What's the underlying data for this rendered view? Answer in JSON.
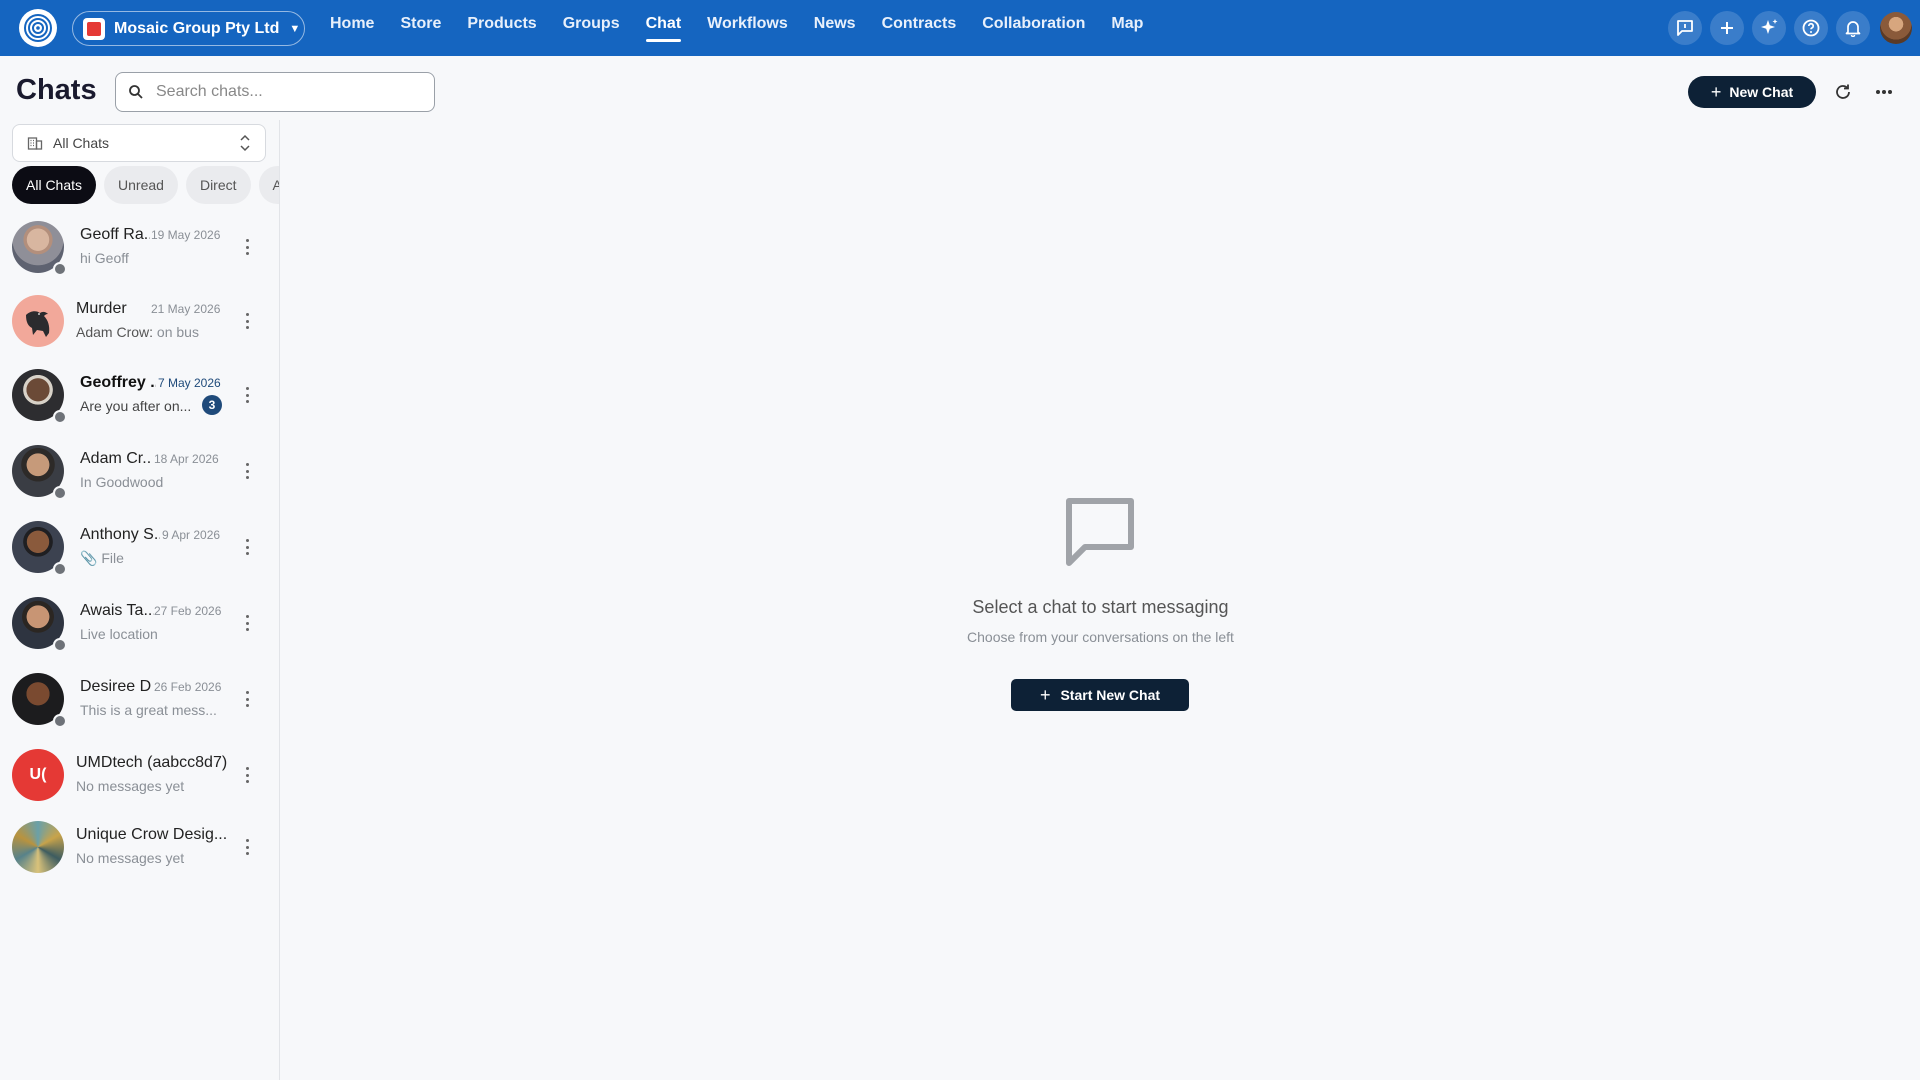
{
  "app": {
    "org_name": "Mosaic Group Pty Ltd",
    "colors": {
      "topbar": "#1565c0",
      "primary_dark": "#0d2136",
      "unread_badge": "#1f4a7a",
      "umd_avatar": "#e53935"
    }
  },
  "nav": {
    "items": [
      {
        "label": "Home"
      },
      {
        "label": "Store"
      },
      {
        "label": "Products"
      },
      {
        "label": "Groups"
      },
      {
        "label": "Chat"
      },
      {
        "label": "Workflows"
      },
      {
        "label": "News"
      },
      {
        "label": "Contracts"
      },
      {
        "label": "Collaboration"
      },
      {
        "label": "Map"
      }
    ],
    "active": "Chat"
  },
  "top_icons": [
    "feedback-icon",
    "plus-icon",
    "sparkles-icon",
    "help-icon",
    "bell-icon"
  ],
  "header": {
    "title": "Chats",
    "search_placeholder": "Search chats...",
    "new_chat_label": "New Chat"
  },
  "sidebar": {
    "filter_select": "All Chats",
    "chips": [
      {
        "label": "All Chats"
      },
      {
        "label": "Unread"
      },
      {
        "label": "Direct"
      },
      {
        "label": "A"
      }
    ],
    "active_chip": "All Chats",
    "chats": [
      {
        "name": "Geoff Ra...",
        "date": "19 May 2026",
        "preview": "hi Geoff",
        "online_dot": true
      },
      {
        "name": "Murder",
        "date": "21 May 2026",
        "sender": "Adam Crow:",
        "preview": " on bus",
        "online_dot": false
      },
      {
        "name": "Geoffrey ...",
        "date": "7 May 2026",
        "preview": "Are you after on...",
        "unread": "3",
        "online_dot": true
      },
      {
        "name": "Adam Cr...",
        "date": "18 Apr 2026",
        "preview": "In Goodwood",
        "online_dot": true
      },
      {
        "name": "Anthony S...",
        "date": "9 Apr 2026",
        "preview": "File",
        "attachment": true,
        "online_dot": true
      },
      {
        "name": "Awais  Ta...",
        "date": "27 Feb 2026",
        "preview": "Live location",
        "online_dot": true
      },
      {
        "name": "Desiree Di",
        "date": "26 Feb 2026",
        "preview": "This is a great mess...",
        "online_dot": true
      },
      {
        "name": "UMDtech (aabcc8d7)",
        "date": "",
        "preview": "No messages yet",
        "avatar_initials": "U(",
        "online_dot": false
      },
      {
        "name": "Unique Crow Desig...",
        "date": "",
        "preview": "No messages yet",
        "online_dot": false
      }
    ]
  },
  "main": {
    "empty_title": "Select a chat to start messaging",
    "empty_subtitle": "Choose from your conversations on the left",
    "start_button": "Start New Chat"
  }
}
